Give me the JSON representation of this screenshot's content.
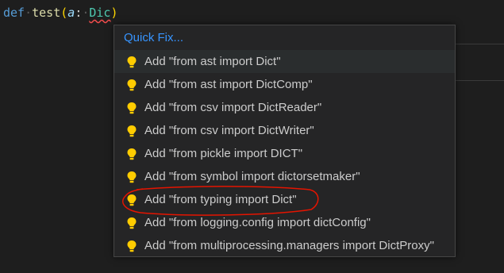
{
  "code": {
    "keyword": "def",
    "function_name": "test",
    "open_paren": "(",
    "param": "a",
    "colon": ":",
    "type_partial": "Dic",
    "close_paren": ")"
  },
  "quickfix": {
    "title": "Quick Fix...",
    "items": [
      {
        "label": "Add \"from ast import Dict\""
      },
      {
        "label": "Add \"from ast import DictComp\""
      },
      {
        "label": "Add \"from csv import DictReader\""
      },
      {
        "label": "Add \"from csv import DictWriter\""
      },
      {
        "label": "Add \"from pickle import DICT\""
      },
      {
        "label": "Add \"from symbol import dictorsetmaker\""
      },
      {
        "label": "Add \"from typing import Dict\""
      },
      {
        "label": "Add \"from logging.config import dictConfig\""
      },
      {
        "label": "Add \"from multiprocessing.managers import DictProxy\""
      }
    ],
    "icon": "lightbulb-icon",
    "bulb_color": "#ffcc00"
  },
  "colors": {
    "editor_bg": "#1e1e1e",
    "menu_bg": "#252526",
    "accent": "#3794ff",
    "annotation_red": "#e51400"
  }
}
